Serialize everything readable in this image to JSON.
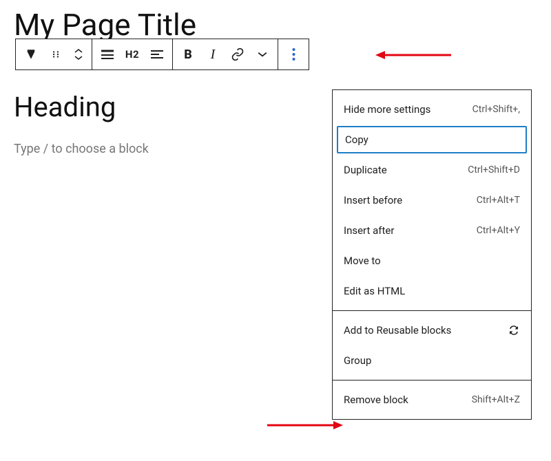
{
  "page": {
    "title": "My Page Title",
    "heading": "Heading",
    "placeholder": "Type / to choose a block"
  },
  "toolbar": {
    "h2": "H2",
    "bold": "B",
    "italic": "I"
  },
  "dropdown": {
    "section1": [
      {
        "label": "Hide more settings",
        "shortcut": "Ctrl+Shift+,"
      },
      {
        "label": "Copy",
        "shortcut": "",
        "selected": true
      },
      {
        "label": "Duplicate",
        "shortcut": "Ctrl+Shift+D"
      },
      {
        "label": "Insert before",
        "shortcut": "Ctrl+Alt+T"
      },
      {
        "label": "Insert after",
        "shortcut": "Ctrl+Alt+Y"
      },
      {
        "label": "Move to",
        "shortcut": ""
      },
      {
        "label": "Edit as HTML",
        "shortcut": ""
      }
    ],
    "section2": [
      {
        "label": "Add to Reusable blocks",
        "icon": "reusable"
      },
      {
        "label": "Group"
      }
    ],
    "section3": [
      {
        "label": "Remove block",
        "shortcut": "Shift+Alt+Z"
      }
    ]
  }
}
